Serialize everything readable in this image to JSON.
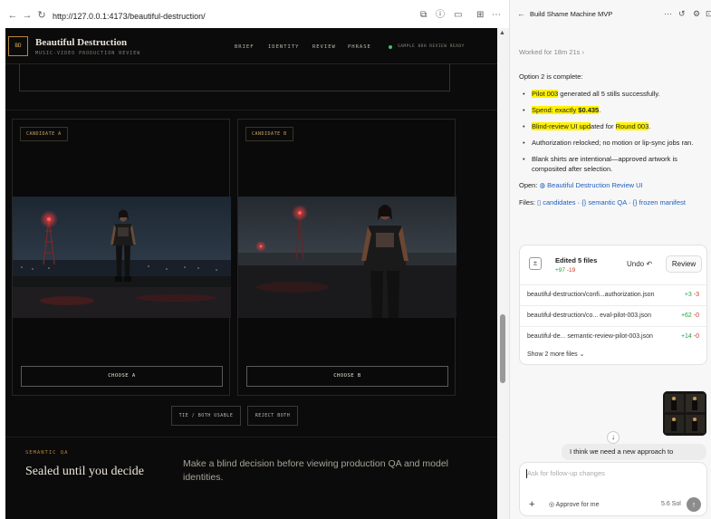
{
  "browser": {
    "url": "http://127.0.0.1:4173/beautiful-destruction/",
    "icons": [
      "back-icon",
      "forward-icon",
      "reload-icon",
      "translate-icon",
      "info-icon",
      "cast-icon",
      "extensions-icon",
      "more-icon"
    ]
  },
  "site": {
    "logo": "BD",
    "brand": "Beautiful Destruction",
    "brand_sub": "MUSIC-VIDEO PRODUCTION REVIEW",
    "nav": [
      "BRIEF",
      "IDENTITY",
      "REVIEW",
      "PHRASE"
    ],
    "status": "SAMPLE 8DH REVIEW READY",
    "candidates": [
      {
        "badge": "CANDIDATE A",
        "button": "CHOOSE A"
      },
      {
        "badge": "CANDIDATE B",
        "button": "CHOOSE B"
      }
    ],
    "tie_button": "TIE / BOTH USABLE",
    "reject_button": "REJECT BOTH",
    "semantic_label": "SEMANTIC QA",
    "semantic_title": "Sealed until you decide",
    "semantic_desc": "Make a blind decision before viewing production QA and model identities."
  },
  "panel": {
    "title": "Build Shame Machine MVP",
    "worked": "Worked for 18m 21s",
    "intro": "Option 2 is complete:",
    "bullets": {
      "b1_hl": "Pilot 003",
      "b1_rest": " generated all 5 stills successfully.",
      "b2_hl": "Spend: exactly ",
      "b2_bold": "$0.435",
      "b2_end": ".",
      "b3_hl1": "Blind-review UI upd",
      "b3_mid": "ated for ",
      "b3_hl2": "Round 003",
      "b3_end": ".",
      "b4": "Authorization relocked; no motion or lip-sync jobs ran.",
      "b5": "Blank shirts are intentional—approved artwork is composited after selection."
    },
    "open_label": "Open:",
    "open_link": "Beautiful Destruction Review UI",
    "files_label": "Files:",
    "file_links": [
      "candidates",
      "semantic QA",
      "frozen manifest"
    ],
    "edits": {
      "title": "Edited 5 files",
      "plus": "+97",
      "minus": "-19",
      "undo": "Undo",
      "review": "Review",
      "rows": [
        {
          "name": "beautiful-destruction/confi...authorization.json",
          "plus": "+3",
          "minus": "-3"
        },
        {
          "name": "beautiful-destruction/co... eval-pilot-003.json",
          "plus": "+62",
          "minus": "-0"
        },
        {
          "name": "beautiful-de... semantic-review-pilot-003.json",
          "plus": "+14",
          "minus": "-0"
        }
      ],
      "show_more": "Show 2 more files"
    },
    "user_message": "I think we need a new approach to",
    "composer_placeholder": "Ask for follow-up changes",
    "approve": "Approve for me",
    "model": "5.6 Sol"
  }
}
